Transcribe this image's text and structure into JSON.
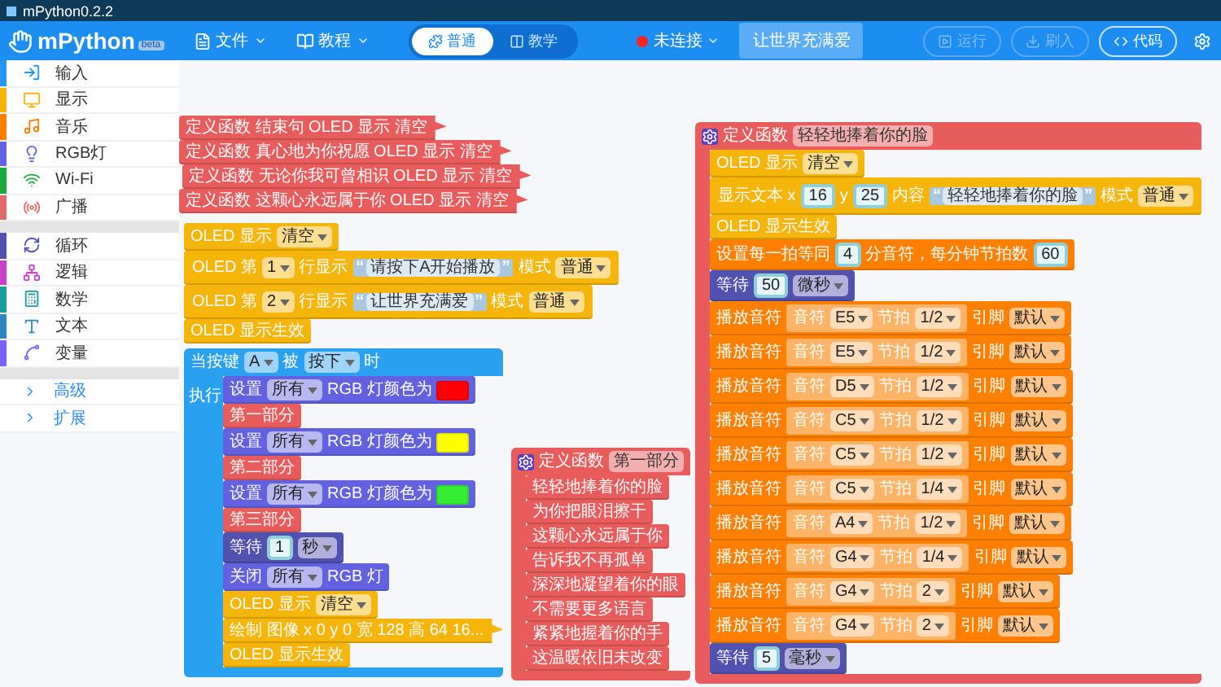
{
  "window": {
    "title": "mPython0.2.2"
  },
  "header": {
    "logo": "mPython",
    "badge": "beta",
    "menus": [
      {
        "label": "文件"
      },
      {
        "label": "教程"
      }
    ],
    "mode_toggle": [
      {
        "label": "普通",
        "selected": true
      },
      {
        "label": "教学",
        "selected": false
      }
    ],
    "connection": {
      "label": "未连接",
      "connected": false
    },
    "project_name": "让世界充满爱",
    "actions": [
      {
        "label": "运行",
        "disabled": true
      },
      {
        "label": "刷入",
        "disabled": true
      },
      {
        "label": "代码",
        "disabled": false
      }
    ]
  },
  "sidebar": {
    "sections": [
      {
        "categories": [
          {
            "label": "输入",
            "color": "#2196f3"
          },
          {
            "label": "显示",
            "color": "#f5b50a"
          },
          {
            "label": "音乐",
            "color": "#ff8000"
          },
          {
            "label": "RGB灯",
            "color": "#6262e6"
          },
          {
            "label": "Wi-Fi",
            "color": "#1aaa3c"
          },
          {
            "label": "广播",
            "color": "#e06a6a"
          }
        ]
      },
      {
        "categories": [
          {
            "label": "循环",
            "color": "#5151b0"
          },
          {
            "label": "逻辑",
            "color": "#c93fc9"
          },
          {
            "label": "数学",
            "color": "#1a9c9c"
          },
          {
            "label": "文本",
            "color": "#2e86c1"
          },
          {
            "label": "变量",
            "color": "#7b61ff"
          }
        ]
      }
    ],
    "more": [
      {
        "label": "高级"
      },
      {
        "label": "扩展"
      }
    ]
  },
  "canvas": {
    "stacks": [
      {
        "blocks": [
          {
            "kind": "collapsed",
            "color": "#e85c5c",
            "parts": [
              {
                "kind": "label",
                "text": "定义函数 结束句 OLED 显示 清空"
              }
            ]
          }
        ]
      },
      {
        "blocks": [
          {
            "kind": "collapsed",
            "color": "#e85c5c",
            "parts": [
              {
                "kind": "label",
                "text": "定义函数 真心地为你祝愿 OLED 显示 清空"
              }
            ]
          }
        ]
      },
      {
        "blocks": [
          {
            "kind": "collapsed",
            "color": "#e85c5c",
            "parts": [
              {
                "kind": "label",
                "text": "定义函数 无论你我可曾相识 OLED 显示 清空"
              }
            ]
          }
        ]
      },
      {
        "blocks": [
          {
            "kind": "collapsed",
            "color": "#e85c5c",
            "parts": [
              {
                "kind": "label",
                "text": "定义函数 这颗心永远属于你 OLED 显示 清空"
              }
            ]
          }
        ]
      },
      {
        "blocks": [
          {
            "kind": "statement",
            "color": "#f5b50a",
            "parts": [
              {
                "kind": "label",
                "text": "OLED 显示"
              },
              {
                "kind": "dropdown",
                "text": "清空"
              }
            ]
          },
          {
            "kind": "statement",
            "color": "#f5b50a",
            "parts": [
              {
                "kind": "label",
                "text": "OLED 第"
              },
              {
                "kind": "dropdown",
                "text": "1"
              },
              {
                "kind": "label",
                "text": "行显示"
              },
              {
                "kind": "string",
                "open": "“",
                "text": "请按下A开始播放",
                "close": "”"
              },
              {
                "kind": "label",
                "text": "模式"
              },
              {
                "kind": "dropdown",
                "text": "普通"
              }
            ]
          },
          {
            "kind": "statement",
            "color": "#f5b50a",
            "parts": [
              {
                "kind": "label",
                "text": "OLED 第"
              },
              {
                "kind": "dropdown",
                "text": "2"
              },
              {
                "kind": "label",
                "text": "行显示"
              },
              {
                "kind": "string",
                "open": "“",
                "text": "让世界充满爱",
                "close": "”"
              },
              {
                "kind": "label",
                "text": "模式"
              },
              {
                "kind": "dropdown",
                "text": "普通"
              }
            ]
          },
          {
            "kind": "statement",
            "color": "#f5b50a",
            "parts": [
              {
                "kind": "label",
                "text": "OLED 显示生效"
              }
            ]
          }
        ]
      },
      {
        "blocks": [
          {
            "kind": "event",
            "color": "#2aa0f0",
            "parts": [
              {
                "kind": "label",
                "text": "当按键"
              },
              {
                "kind": "dropdown",
                "text": "A"
              },
              {
                "kind": "label",
                "text": "被"
              },
              {
                "kind": "dropdown",
                "text": "按下"
              },
              {
                "kind": "label",
                "text": "时"
              }
            ],
            "body_label": "执行",
            "children": [
              {
                "kind": "statement",
                "color": "#6262e0",
                "parts": [
                  {
                    "kind": "label",
                    "text": "设置"
                  },
                  {
                    "kind": "dropdown",
                    "text": "所有"
                  },
                  {
                    "kind": "label",
                    "text": "RGB 灯颜色为"
                  },
                  {
                    "kind": "swatch",
                    "color": "#ff0000"
                  }
                ]
              },
              {
                "kind": "statement",
                "color": "#e85c5c",
                "parts": [
                  {
                    "kind": "label",
                    "text": "第一部分"
                  }
                ]
              },
              {
                "kind": "statement",
                "color": "#6262e0",
                "parts": [
                  {
                    "kind": "label",
                    "text": "设置"
                  },
                  {
                    "kind": "dropdown",
                    "text": "所有"
                  },
                  {
                    "kind": "label",
                    "text": "RGB 灯颜色为"
                  },
                  {
                    "kind": "swatch",
                    "color": "#ffff00"
                  }
                ]
              },
              {
                "kind": "statement",
                "color": "#e85c5c",
                "parts": [
                  {
                    "kind": "label",
                    "text": "第二部分"
                  }
                ]
              },
              {
                "kind": "statement",
                "color": "#6262e0",
                "parts": [
                  {
                    "kind": "label",
                    "text": "设置"
                  },
                  {
                    "kind": "dropdown",
                    "text": "所有"
                  },
                  {
                    "kind": "label",
                    "text": "RGB 灯颜色为"
                  },
                  {
                    "kind": "swatch",
                    "color": "#33ee33"
                  }
                ]
              },
              {
                "kind": "statement",
                "color": "#e85c5c",
                "parts": [
                  {
                    "kind": "label",
                    "text": "第三部分"
                  }
                ]
              },
              {
                "kind": "statement",
                "color": "#5151b0",
                "parts": [
                  {
                    "kind": "label",
                    "text": "等待"
                  },
                  {
                    "kind": "number",
                    "text": "1"
                  },
                  {
                    "kind": "dropdown",
                    "text": "秒"
                  }
                ]
              },
              {
                "kind": "statement",
                "color": "#6262e0",
                "parts": [
                  {
                    "kind": "label",
                    "text": "关闭"
                  },
                  {
                    "kind": "dropdown",
                    "text": "所有"
                  },
                  {
                    "kind": "label",
                    "text": "RGB 灯"
                  }
                ]
              },
              {
                "kind": "statement",
                "color": "#f5b50a",
                "parts": [
                  {
                    "kind": "label",
                    "text": "OLED 显示"
                  },
                  {
                    "kind": "dropdown",
                    "text": "清空"
                  }
                ]
              },
              {
                "kind": "collapsed",
                "color": "#f5b50a",
                "parts": [
                  {
                    "kind": "label",
                    "text": "绘制 图像 x 0 y 0 宽 128 高 64 16..."
                  }
                ]
              },
              {
                "kind": "statement",
                "color": "#f5b50a",
                "parts": [
                  {
                    "kind": "label",
                    "text": "OLED 显示生效"
                  }
                ]
              }
            ]
          }
        ]
      },
      {
        "blocks": [
          {
            "kind": "define",
            "color": "#e85c5c",
            "parts": [
              {
                "kind": "label",
                "text": "定义函数"
              },
              {
                "kind": "name",
                "text": "第一部分"
              }
            ],
            "children": [
              {
                "kind": "statement",
                "color": "#e85c5c",
                "parts": [
                  {
                    "kind": "label",
                    "text": "轻轻地捧着你的脸"
                  }
                ]
              },
              {
                "kind": "statement",
                "color": "#e85c5c",
                "parts": [
                  {
                    "kind": "label",
                    "text": "为你把眼泪擦干"
                  }
                ]
              },
              {
                "kind": "statement",
                "color": "#e85c5c",
                "parts": [
                  {
                    "kind": "label",
                    "text": "这颗心永远属于你"
                  }
                ]
              },
              {
                "kind": "statement",
                "color": "#e85c5c",
                "parts": [
                  {
                    "kind": "label",
                    "text": "告诉我不再孤单"
                  }
                ]
              },
              {
                "kind": "statement",
                "color": "#e85c5c",
                "parts": [
                  {
                    "kind": "label",
                    "text": "深深地凝望着你的眼"
                  }
                ]
              },
              {
                "kind": "statement",
                "color": "#e85c5c",
                "parts": [
                  {
                    "kind": "label",
                    "text": "不需要更多语言"
                  }
                ]
              },
              {
                "kind": "statement",
                "color": "#e85c5c",
                "parts": [
                  {
                    "kind": "label",
                    "text": "紧紧地握着你的手"
                  }
                ]
              },
              {
                "kind": "statement",
                "color": "#e85c5c",
                "parts": [
                  {
                    "kind": "label",
                    "text": "这温暖依旧未改变"
                  }
                ]
              }
            ]
          }
        ]
      },
      {
        "blocks": [
          {
            "kind": "define",
            "color": "#e85c5c",
            "parts": [
              {
                "kind": "label",
                "text": "定义函数"
              },
              {
                "kind": "name",
                "text": "轻轻地捧着你的脸"
              }
            ],
            "children": [
              {
                "kind": "statement",
                "color": "#f5b50a",
                "parts": [
                  {
                    "kind": "label",
                    "text": "OLED 显示"
                  },
                  {
                    "kind": "dropdown",
                    "text": "清空"
                  }
                ]
              },
              {
                "kind": "statement",
                "color": "#f5b50a",
                "parts": [
                  {
                    "kind": "label",
                    "text": "显示文本 x"
                  },
                  {
                    "kind": "number",
                    "text": "16"
                  },
                  {
                    "kind": "label",
                    "text": "y"
                  },
                  {
                    "kind": "number",
                    "text": "25"
                  },
                  {
                    "kind": "label",
                    "text": "内容"
                  },
                  {
                    "kind": "string",
                    "open": "“",
                    "text": "轻轻地捧着你的脸",
                    "close": "”"
                  },
                  {
                    "kind": "label",
                    "text": "模式"
                  },
                  {
                    "kind": "dropdown",
                    "text": "普通"
                  }
                ]
              },
              {
                "kind": "statement",
                "color": "#f5b50a",
                "parts": [
                  {
                    "kind": "label",
                    "text": "OLED 显示生效"
                  }
                ]
              },
              {
                "kind": "statement",
                "color": "#ff8000",
                "parts": [
                  {
                    "kind": "label",
                    "text": "设置每一拍等同"
                  },
                  {
                    "kind": "number",
                    "text": "4"
                  },
                  {
                    "kind": "label",
                    "text": "分音符，每分钟节拍数"
                  },
                  {
                    "kind": "number",
                    "text": "60"
                  }
                ]
              },
              {
                "kind": "statement",
                "color": "#5151b0",
                "parts": [
                  {
                    "kind": "label",
                    "text": "等待"
                  },
                  {
                    "kind": "number",
                    "text": "50"
                  },
                  {
                    "kind": "dropdown",
                    "text": "微秒"
                  }
                ]
              },
              {
                "kind": "statement",
                "color": "#ff8000",
                "parts": [
                  {
                    "kind": "label",
                    "text": "播放音符"
                  },
                  {
                    "kind": "group",
                    "parts": [
                      {
                        "kind": "label",
                        "text": "音符"
                      },
                      {
                        "kind": "dropdown",
                        "text": "E5"
                      },
                      {
                        "kind": "label",
                        "text": "节拍"
                      },
                      {
                        "kind": "dropdown",
                        "text": "1/2"
                      }
                    ]
                  },
                  {
                    "kind": "label",
                    "text": "引脚"
                  },
                  {
                    "kind": "dropdown",
                    "text": "默认"
                  }
                ]
              },
              {
                "kind": "statement",
                "color": "#ff8000",
                "parts": [
                  {
                    "kind": "label",
                    "text": "播放音符"
                  },
                  {
                    "kind": "group",
                    "parts": [
                      {
                        "kind": "label",
                        "text": "音符"
                      },
                      {
                        "kind": "dropdown",
                        "text": "E5"
                      },
                      {
                        "kind": "label",
                        "text": "节拍"
                      },
                      {
                        "kind": "dropdown",
                        "text": "1/2"
                      }
                    ]
                  },
                  {
                    "kind": "label",
                    "text": "引脚"
                  },
                  {
                    "kind": "dropdown",
                    "text": "默认"
                  }
                ]
              },
              {
                "kind": "statement",
                "color": "#ff8000",
                "parts": [
                  {
                    "kind": "label",
                    "text": "播放音符"
                  },
                  {
                    "kind": "group",
                    "parts": [
                      {
                        "kind": "label",
                        "text": "音符"
                      },
                      {
                        "kind": "dropdown",
                        "text": "D5"
                      },
                      {
                        "kind": "label",
                        "text": "节拍"
                      },
                      {
                        "kind": "dropdown",
                        "text": "1/2"
                      }
                    ]
                  },
                  {
                    "kind": "label",
                    "text": "引脚"
                  },
                  {
                    "kind": "dropdown",
                    "text": "默认"
                  }
                ]
              },
              {
                "kind": "statement",
                "color": "#ff8000",
                "parts": [
                  {
                    "kind": "label",
                    "text": "播放音符"
                  },
                  {
                    "kind": "group",
                    "parts": [
                      {
                        "kind": "label",
                        "text": "音符"
                      },
                      {
                        "kind": "dropdown",
                        "text": "C5"
                      },
                      {
                        "kind": "label",
                        "text": "节拍"
                      },
                      {
                        "kind": "dropdown",
                        "text": "1/2"
                      }
                    ]
                  },
                  {
                    "kind": "label",
                    "text": "引脚"
                  },
                  {
                    "kind": "dropdown",
                    "text": "默认"
                  }
                ]
              },
              {
                "kind": "statement",
                "color": "#ff8000",
                "parts": [
                  {
                    "kind": "label",
                    "text": "播放音符"
                  },
                  {
                    "kind": "group",
                    "parts": [
                      {
                        "kind": "label",
                        "text": "音符"
                      },
                      {
                        "kind": "dropdown",
                        "text": "C5"
                      },
                      {
                        "kind": "label",
                        "text": "节拍"
                      },
                      {
                        "kind": "dropdown",
                        "text": "1/2"
                      }
                    ]
                  },
                  {
                    "kind": "label",
                    "text": "引脚"
                  },
                  {
                    "kind": "dropdown",
                    "text": "默认"
                  }
                ]
              },
              {
                "kind": "statement",
                "color": "#ff8000",
                "parts": [
                  {
                    "kind": "label",
                    "text": "播放音符"
                  },
                  {
                    "kind": "group",
                    "parts": [
                      {
                        "kind": "label",
                        "text": "音符"
                      },
                      {
                        "kind": "dropdown",
                        "text": "C5"
                      },
                      {
                        "kind": "label",
                        "text": "节拍"
                      },
                      {
                        "kind": "dropdown",
                        "text": "1/4"
                      }
                    ]
                  },
                  {
                    "kind": "label",
                    "text": "引脚"
                  },
                  {
                    "kind": "dropdown",
                    "text": "默认"
                  }
                ]
              },
              {
                "kind": "statement",
                "color": "#ff8000",
                "parts": [
                  {
                    "kind": "label",
                    "text": "播放音符"
                  },
                  {
                    "kind": "group",
                    "parts": [
                      {
                        "kind": "label",
                        "text": "音符"
                      },
                      {
                        "kind": "dropdown",
                        "text": "A4"
                      },
                      {
                        "kind": "label",
                        "text": "节拍"
                      },
                      {
                        "kind": "dropdown",
                        "text": "1/2"
                      }
                    ]
                  },
                  {
                    "kind": "label",
                    "text": "引脚"
                  },
                  {
                    "kind": "dropdown",
                    "text": "默认"
                  }
                ]
              },
              {
                "kind": "statement",
                "color": "#ff8000",
                "parts": [
                  {
                    "kind": "label",
                    "text": "播放音符"
                  },
                  {
                    "kind": "group",
                    "parts": [
                      {
                        "kind": "label",
                        "text": "音符"
                      },
                      {
                        "kind": "dropdown",
                        "text": "G4"
                      },
                      {
                        "kind": "label",
                        "text": "节拍"
                      },
                      {
                        "kind": "dropdown",
                        "text": "1/4"
                      }
                    ]
                  },
                  {
                    "kind": "label",
                    "text": "引脚"
                  },
                  {
                    "kind": "dropdown",
                    "text": "默认"
                  }
                ]
              },
              {
                "kind": "statement",
                "color": "#ff8000",
                "parts": [
                  {
                    "kind": "label",
                    "text": "播放音符"
                  },
                  {
                    "kind": "group",
                    "parts": [
                      {
                        "kind": "label",
                        "text": "音符"
                      },
                      {
                        "kind": "dropdown",
                        "text": "G4"
                      },
                      {
                        "kind": "label",
                        "text": "节拍"
                      },
                      {
                        "kind": "dropdown",
                        "text": "2"
                      }
                    ]
                  },
                  {
                    "kind": "label",
                    "text": "引脚"
                  },
                  {
                    "kind": "dropdown",
                    "text": "默认"
                  }
                ]
              },
              {
                "kind": "statement",
                "color": "#ff8000",
                "parts": [
                  {
                    "kind": "label",
                    "text": "播放音符"
                  },
                  {
                    "kind": "group",
                    "parts": [
                      {
                        "kind": "label",
                        "text": "音符"
                      },
                      {
                        "kind": "dropdown",
                        "text": "G4"
                      },
                      {
                        "kind": "label",
                        "text": "节拍"
                      },
                      {
                        "kind": "dropdown",
                        "text": "2"
                      }
                    ]
                  },
                  {
                    "kind": "label",
                    "text": "引脚"
                  },
                  {
                    "kind": "dropdown",
                    "text": "默认"
                  }
                ]
              },
              {
                "kind": "statement",
                "color": "#5151b0",
                "parts": [
                  {
                    "kind": "label",
                    "text": "等待"
                  },
                  {
                    "kind": "number",
                    "text": "5"
                  },
                  {
                    "kind": "dropdown",
                    "text": "毫秒"
                  }
                ]
              }
            ]
          }
        ]
      }
    ]
  }
}
